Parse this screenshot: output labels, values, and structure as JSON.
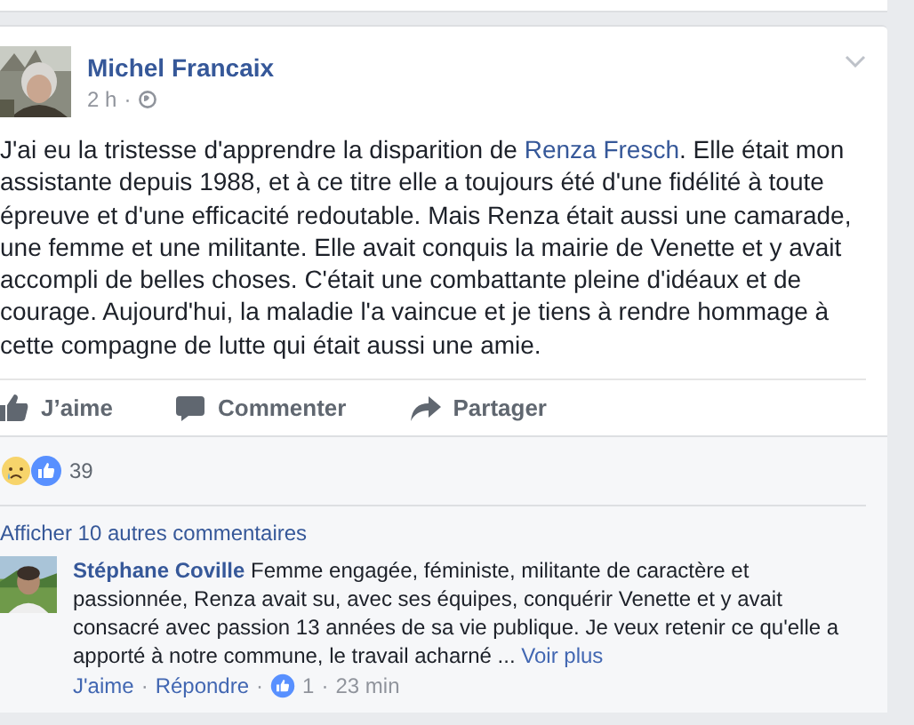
{
  "post": {
    "author": "Michel Francaix",
    "time": "2 h",
    "separator": "·",
    "text_before": "J'ai eu la tristesse d'apprendre la disparition de ",
    "mention": "Renza Fresch",
    "text_after": ". Elle était mon assistante depuis 1988, et à ce titre elle a toujours été d'une fidélité à toute épreuve et d'une efficacité redoutable. Mais Renza était aussi une camarade, une femme et une militante. Elle avait conquis la mairie de Venette et y avait accompli de belles choses. C'était une combattante pleine d'idéaux et de courage. Aujourd'hui, la maladie l'a vaincue et je tiens à rendre hommage à cette compagne de lutte qui était aussi une amie."
  },
  "actions": [
    {
      "kind": "like",
      "label": "J’aime"
    },
    {
      "kind": "comment",
      "label": "Commenter"
    },
    {
      "kind": "share",
      "label": "Partager"
    }
  ],
  "reactions": {
    "count": "39"
  },
  "more_comments": "Afficher 10 autres commentaires",
  "comment": {
    "author": "Stéphane Coville",
    "text": "Femme engagée, féministe, militante de caractère et passionnée, Renza avait su, avec ses équipes, conquérir Venette et y avait consacré avec passion 13 années de sa vie publique. Je veux retenir ce qu'elle a apporté à notre commune, le travail acharné ...",
    "see_more": "Voir plus",
    "like": "J'aime",
    "reply": "Répondre",
    "likes": "1",
    "time": "23 min",
    "separator": "·"
  }
}
